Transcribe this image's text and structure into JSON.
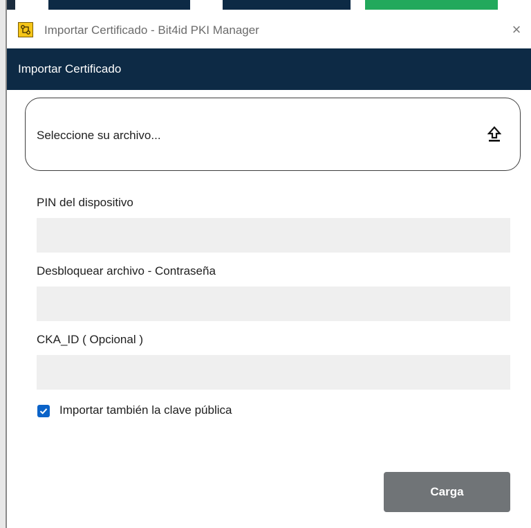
{
  "window": {
    "title": "Importar Certificado - Bit4id PKI Manager",
    "close_glyph": "×"
  },
  "header": {
    "title": "Importar Certificado"
  },
  "file_picker": {
    "label": "Seleccione su archivo...",
    "icon": "upload-icon"
  },
  "fields": {
    "pin_label": "PIN del dispositivo",
    "pin_value": "",
    "password_label": "Desbloquear archivo - Contraseña",
    "password_value": "",
    "cka_label": "CKA_ID ( Opcional )",
    "cka_value": ""
  },
  "options": {
    "import_public_key_label": "Importar también la clave pública",
    "import_public_key_checked": true
  },
  "actions": {
    "submit_label": "Carga"
  },
  "colors": {
    "header_bg": "#0d2a45",
    "accent_blue": "#0b63c8",
    "button_gray": "#707477",
    "input_bg": "#efefef"
  }
}
